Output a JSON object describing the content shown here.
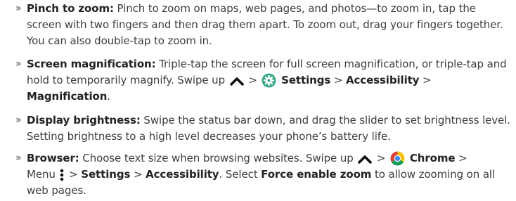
{
  "bullet_marker": "»",
  "items": [
    {
      "title": "Pinch to zoom:",
      "text": "Pinch to zoom on maps, web pages, and photos—to zoom in, tap the screen with two fingers and then drag them apart. To zoom out, drag your fingers together. You can also double-tap to zoom in."
    },
    {
      "title": "Screen magnification:",
      "text_1": "Triple-tap the screen for full screen magnification, or triple-tap and hold to temporarily magnify. Swipe up",
      "sep_1": ">",
      "settings": "Settings",
      "sep_2": ">",
      "accessibility": "Accessibility",
      "sep_3": ">",
      "magnification": "Magnification",
      "end": "."
    },
    {
      "title": "Display brightness:",
      "text": "Swipe the status bar down, and drag the slider to set brightness level. Setting brightness to a high level decreases your phone’s battery life."
    },
    {
      "title": "Browser:",
      "text_1": "Choose text size when browsing websites. Swipe up",
      "sep_1": ">",
      "chrome": "Chrome",
      "sep_2": ">",
      "menu": "Menu",
      "sep_3": ">",
      "settings": "Settings",
      "sep_4": ">",
      "accessibility": "Accessibility",
      "text_2": ". Select",
      "force_zoom": "Force enable zoom",
      "text_3": "to allow zooming on all web pages."
    }
  ],
  "icons": {
    "swipe_up": "chevron-up-icon",
    "settings": "settings-gear-icon",
    "chrome": "chrome-icon",
    "menu": "vertical-dots-menu-icon"
  },
  "colors": {
    "settings_icon": "#3aa88c",
    "chrome_red": "#db4437",
    "chrome_yellow": "#f4c20d",
    "chrome_green": "#0f9d58",
    "chrome_blue": "#4285f4"
  }
}
